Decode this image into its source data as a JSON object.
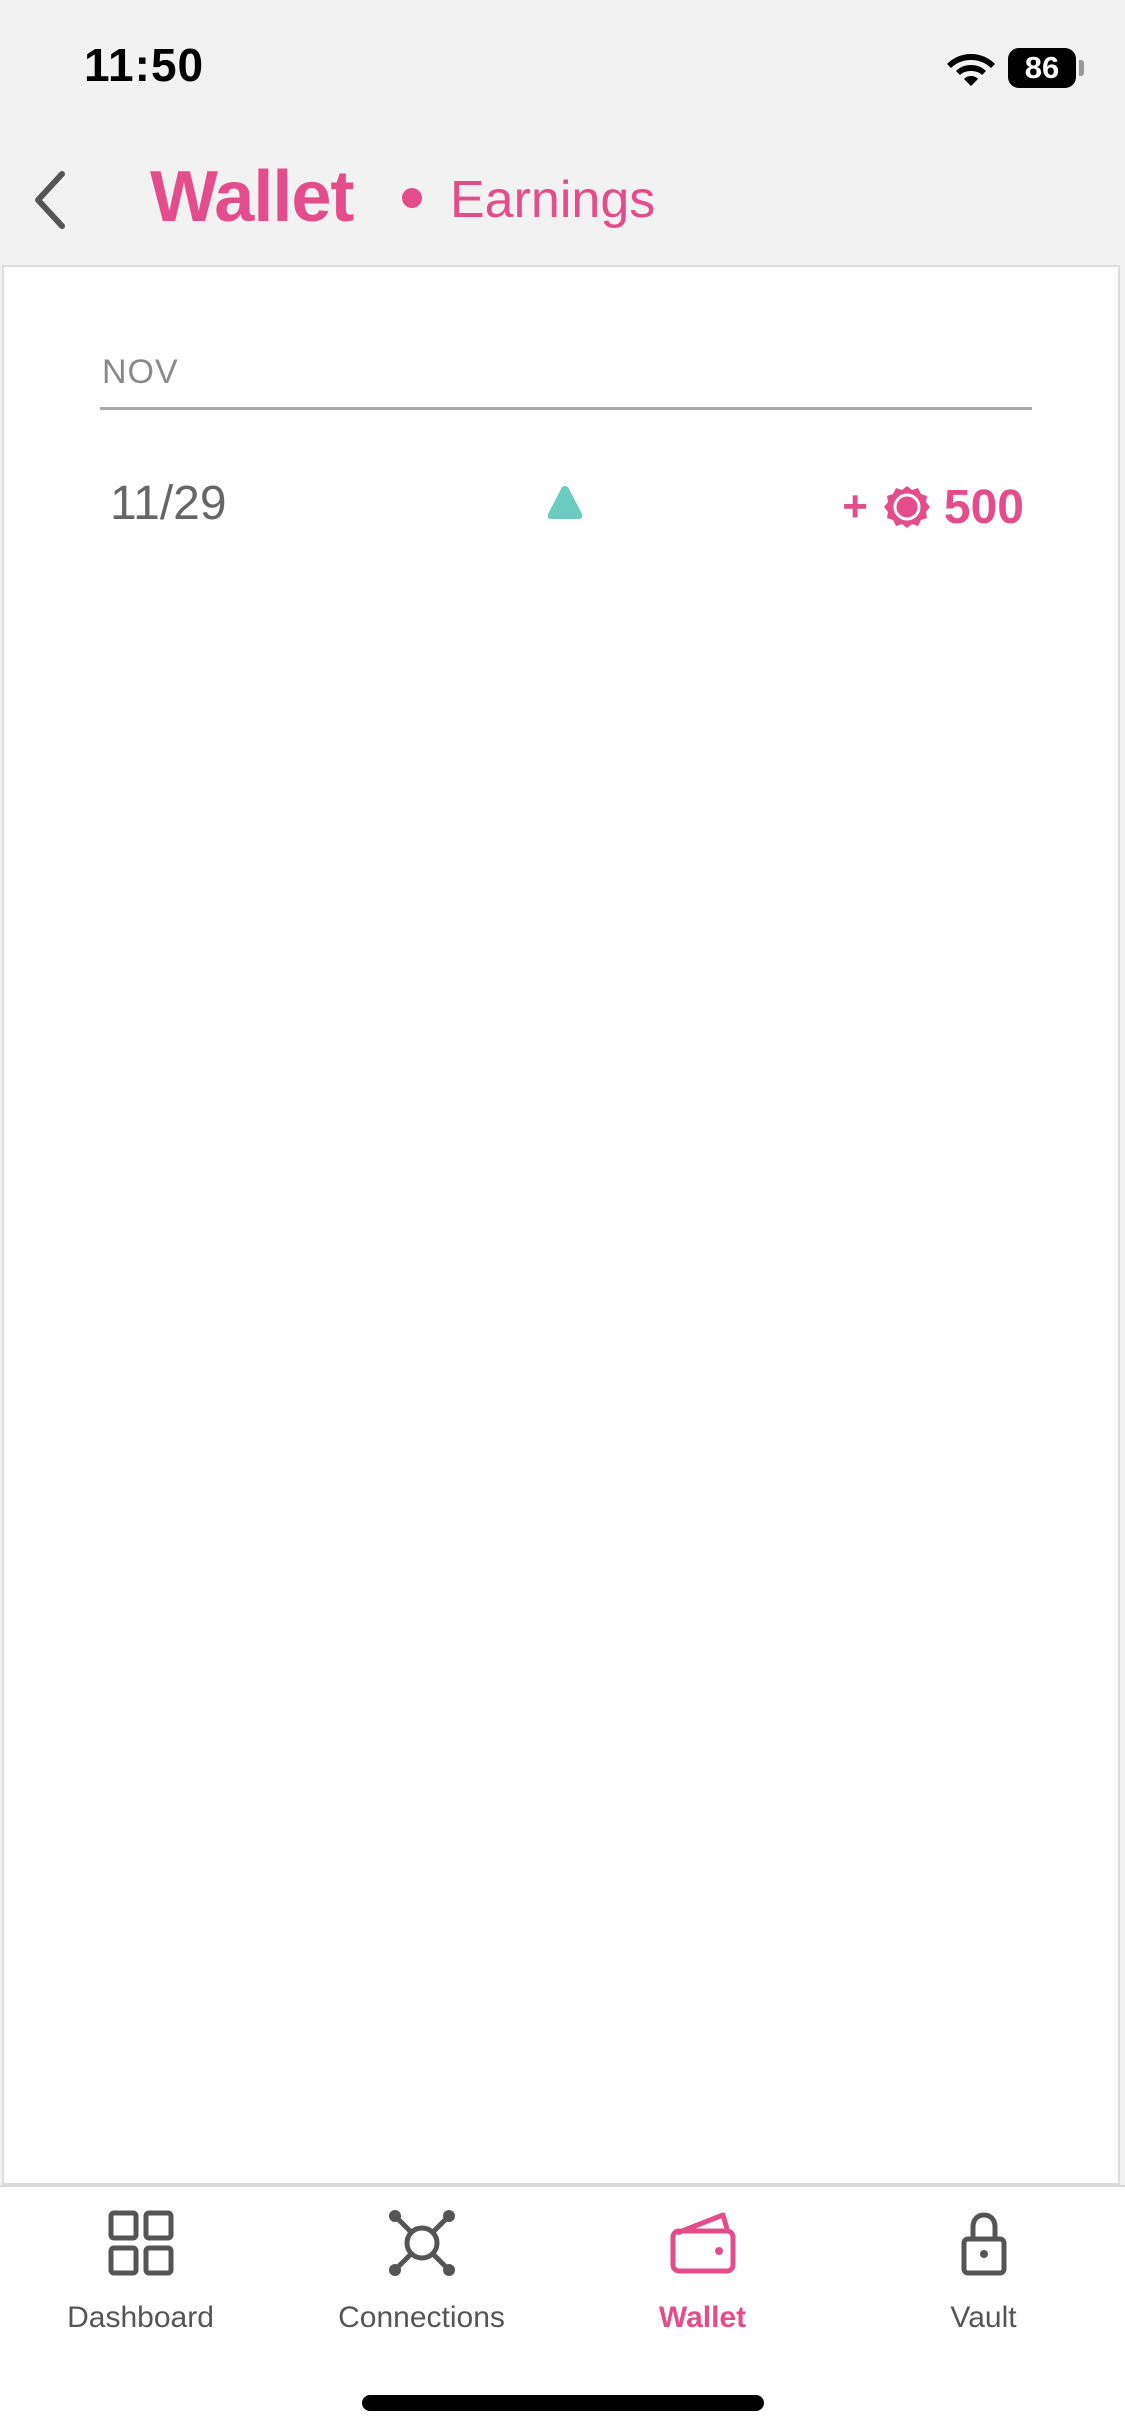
{
  "status_bar": {
    "time": "11:50",
    "battery": "86",
    "icons": [
      "wifi-icon",
      "battery-icon"
    ]
  },
  "header": {
    "title": "Wallet",
    "subtitle": "Earnings",
    "back_icon": "chevron-left-icon"
  },
  "colors": {
    "accent": "#e44d8b",
    "earning_icon": "#6ccbbf",
    "text_secondary": "#666666",
    "nav_inactive": "#555555"
  },
  "transactions": {
    "month": "NOV",
    "rows": [
      {
        "date": "11/29",
        "type_icon": "triangle-up-icon",
        "sign": "+",
        "coin_icon": "coin-icon",
        "value": "500"
      }
    ]
  },
  "nav": {
    "items": [
      {
        "label": "Dashboard",
        "icon": "grid-icon",
        "active": false
      },
      {
        "label": "Connections",
        "icon": "connections-icon",
        "active": false
      },
      {
        "label": "Wallet",
        "icon": "wallet-icon",
        "active": true
      },
      {
        "label": "Vault",
        "icon": "lock-icon",
        "active": false
      }
    ]
  }
}
